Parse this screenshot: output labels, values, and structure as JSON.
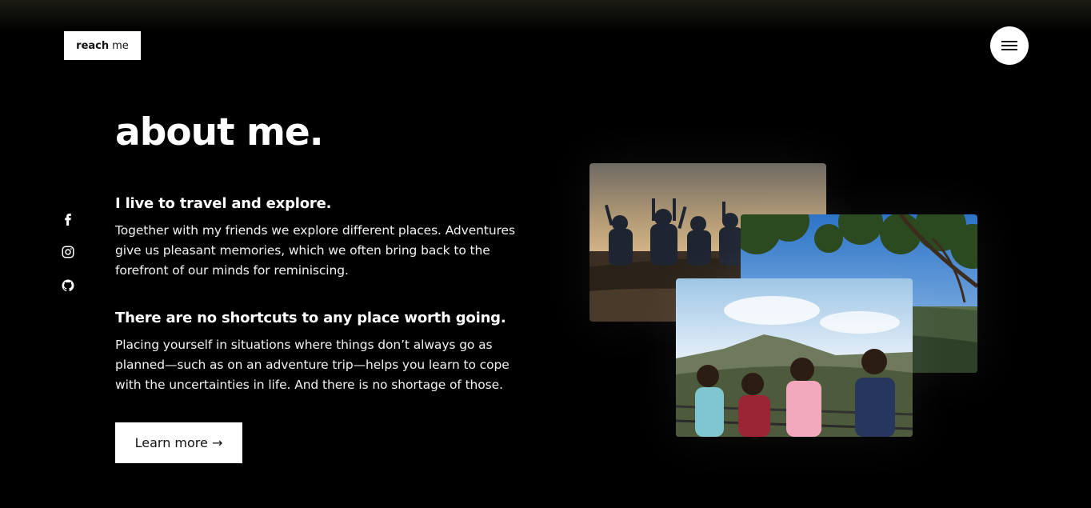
{
  "header": {
    "logo_bold": "reach",
    "logo_light": "me",
    "menu_icon": "hamburger-icon"
  },
  "social": [
    {
      "icon": "facebook-icon"
    },
    {
      "icon": "instagram-icon"
    },
    {
      "icon": "github-icon"
    }
  ],
  "about": {
    "title": "about me.",
    "section1": {
      "heading": "I live to travel and explore.",
      "body": "Together with my friends we explore different places. Adventures give us pleasant memories, which we often bring back to the forefront of our minds for reminiscing."
    },
    "section2": {
      "heading": "There are no shortcuts to any place worth going.",
      "body": "Placing yourself in situations where things don’t always go as planned—such as on an adventure trip—helps you learn to cope with the uncertainties in life. And there is no shortage of those."
    },
    "cta_label": "Learn more →"
  },
  "colors": {
    "background": "#000000",
    "text": "#ffffff",
    "button_bg": "#ffffff",
    "button_text": "#111111"
  }
}
